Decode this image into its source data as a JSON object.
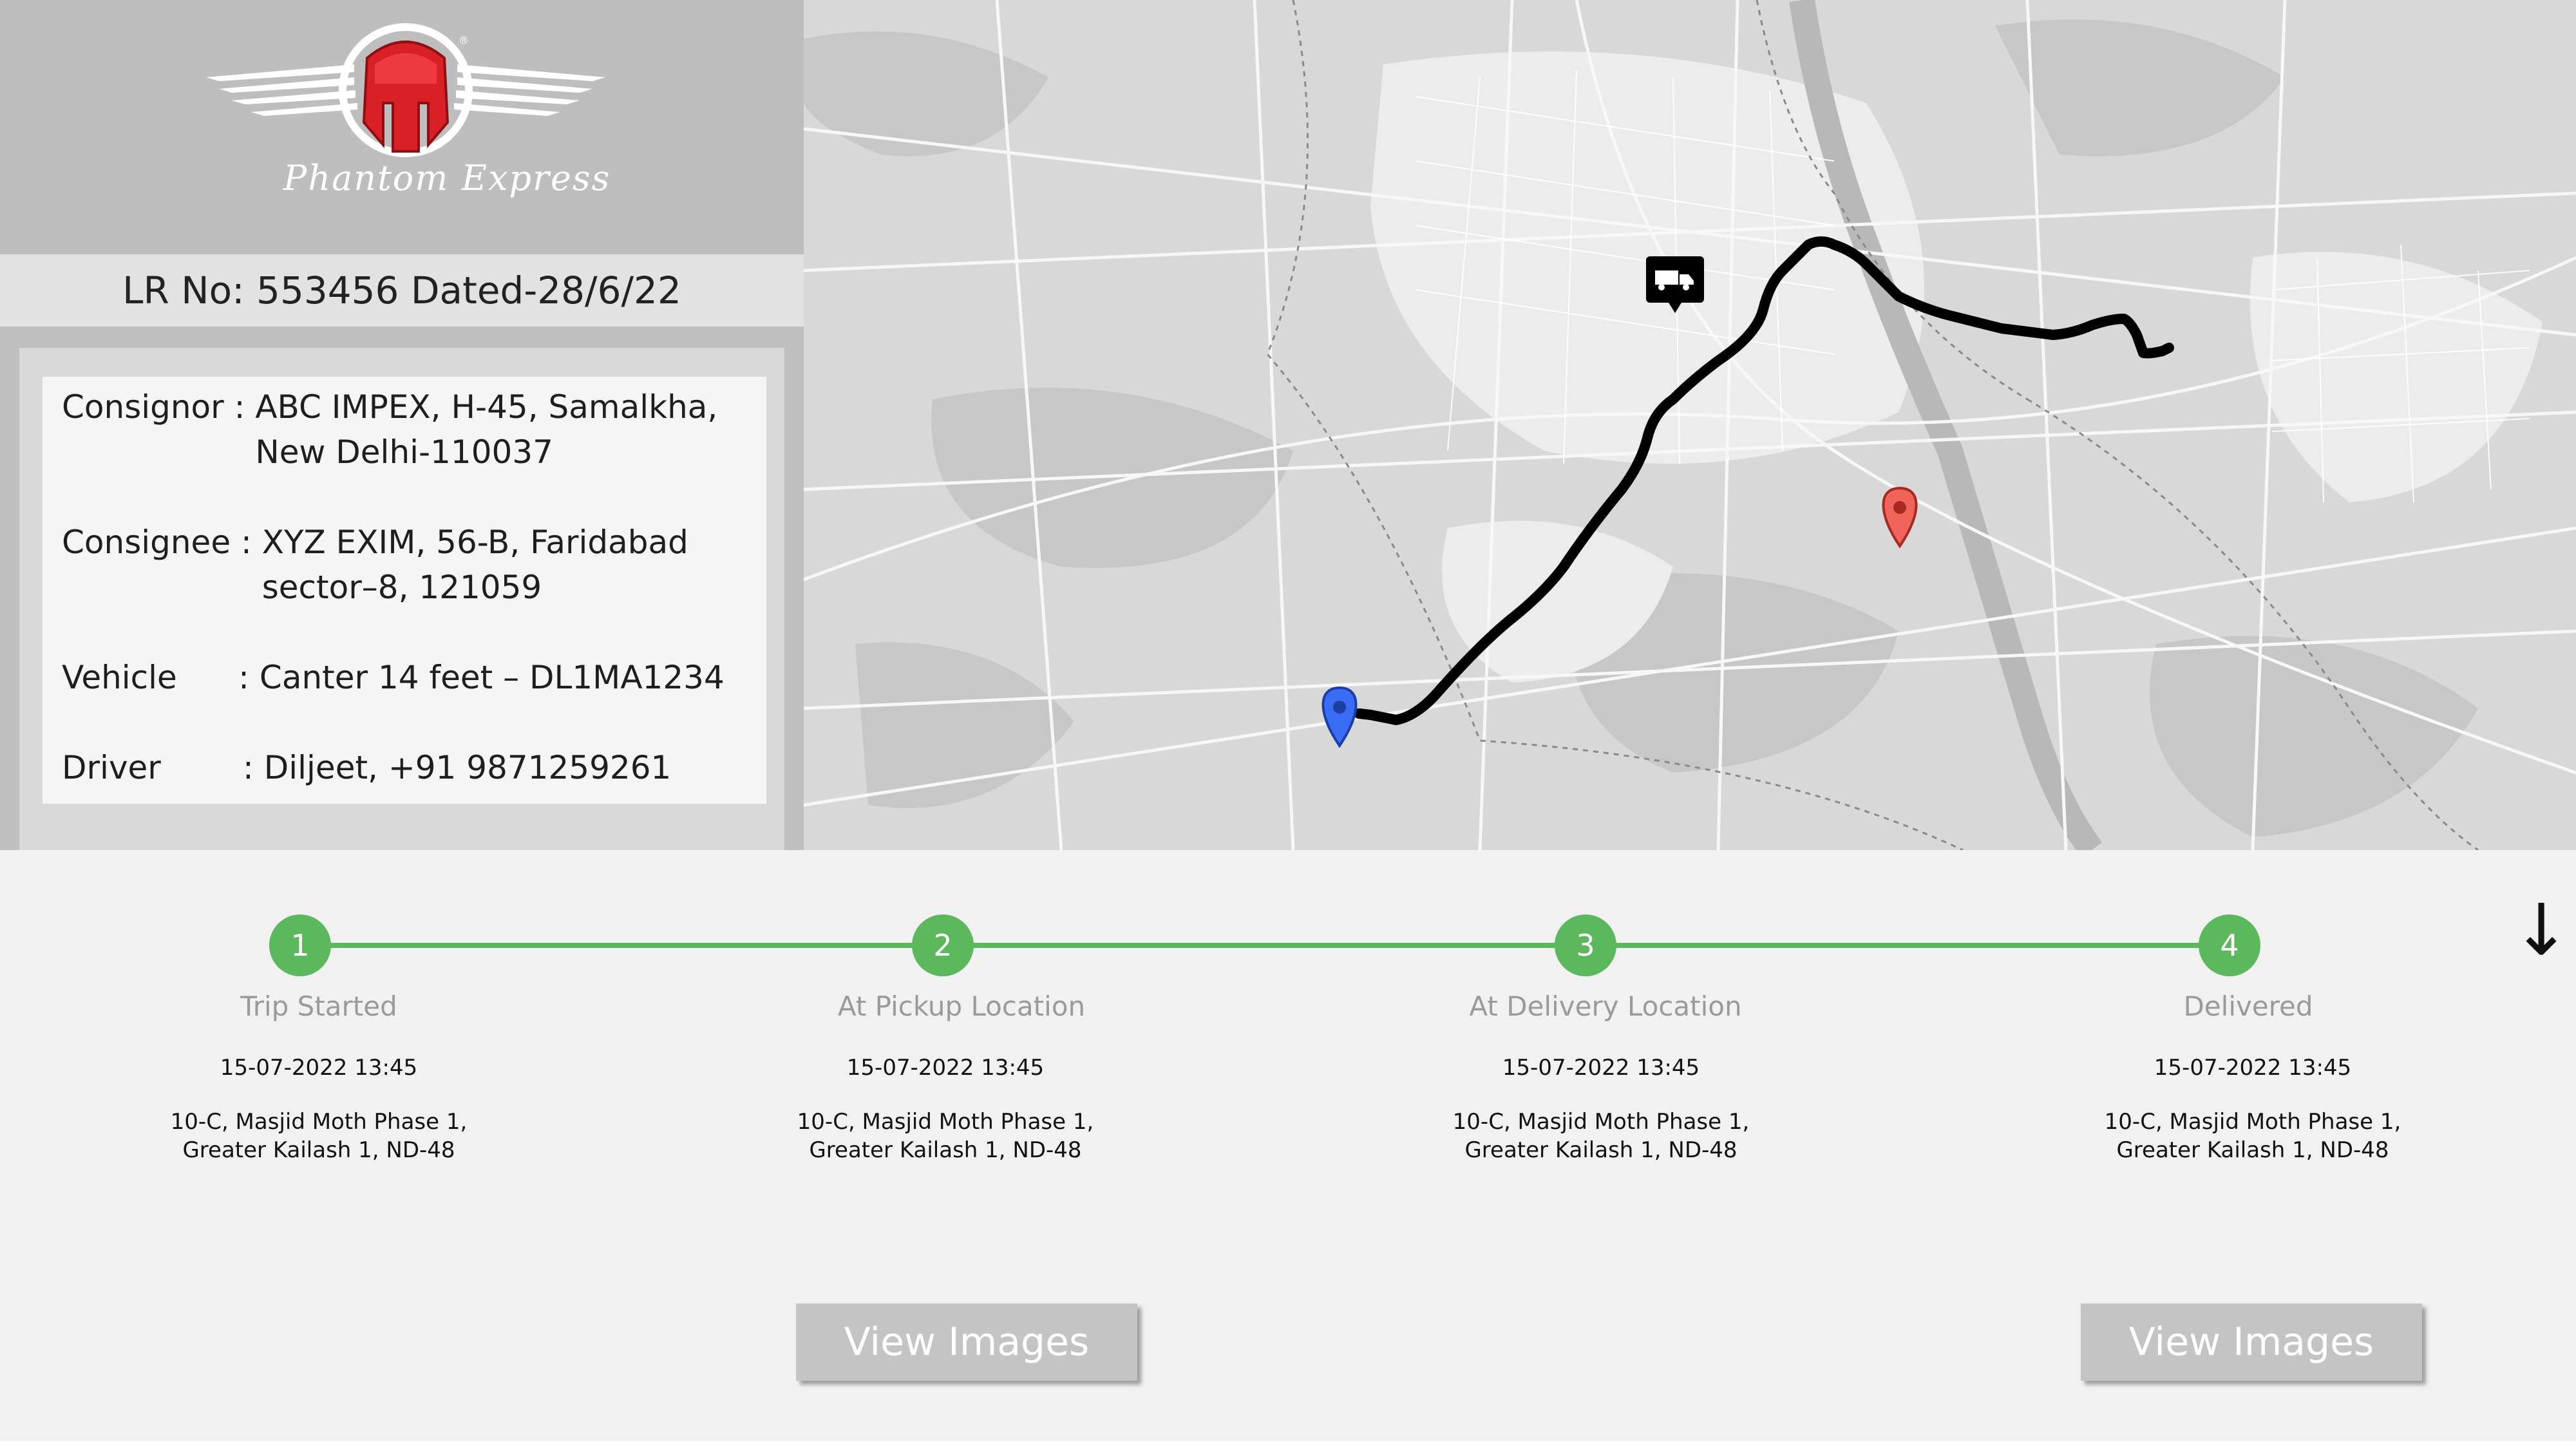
{
  "brand": {
    "name": "Phantom Express",
    "logo_icon": "spartan-helmet-icon",
    "accent": "#e31e24"
  },
  "lr": {
    "text": "LR No: 553456 Dated-28/6/22"
  },
  "details": [
    {
      "label": "Consignor : ",
      "value": "ABC IMPEX, H-45, Samalkha, New Delhi-110037"
    },
    {
      "label": "Consignee : ",
      "value": "XYZ EXIM, 56-B, Faridabad sector–8, 121059"
    },
    {
      "label": "Vehicle      : ",
      "value": "Canter 14 feet – DL1MA1234"
    },
    {
      "label": "Driver        : ",
      "value": "Diljeet, +91 9871259261"
    }
  ],
  "map": {
    "truck_icon": "truck-icon",
    "origin_pin": "blue-map-pin-icon",
    "destination_pin": "red-map-pin-icon",
    "route_color": "#000000"
  },
  "timeline": {
    "line_color": "#5cb85c",
    "steps": [
      {
        "number": "1",
        "title": "Trip Started",
        "time": "15-07-2022 13:45",
        "addr1": "10-C, Masjid Moth Phase 1,",
        "addr2": "Greater Kailash 1, ND-48"
      },
      {
        "number": "2",
        "title": "At Pickup Location",
        "time": "15-07-2022 13:45",
        "addr1": "10-C, Masjid Moth Phase 1,",
        "addr2": "Greater Kailash 1, ND-48"
      },
      {
        "number": "3",
        "title": "At Delivery Location",
        "time": "15-07-2022 13:45",
        "addr1": "10-C, Masjid Moth Phase 1,",
        "addr2": "Greater Kailash 1, ND-48"
      },
      {
        "number": "4",
        "title": "Delivered",
        "time": "15-07-2022 13:45",
        "addr1": "10-C, Masjid Moth Phase 1,",
        "addr2": "Greater Kailash 1, ND-48"
      }
    ]
  },
  "buttons": {
    "view_images_pickup": "View Images",
    "view_images_delivered": "View Images"
  },
  "scroll_arrow": "↓"
}
